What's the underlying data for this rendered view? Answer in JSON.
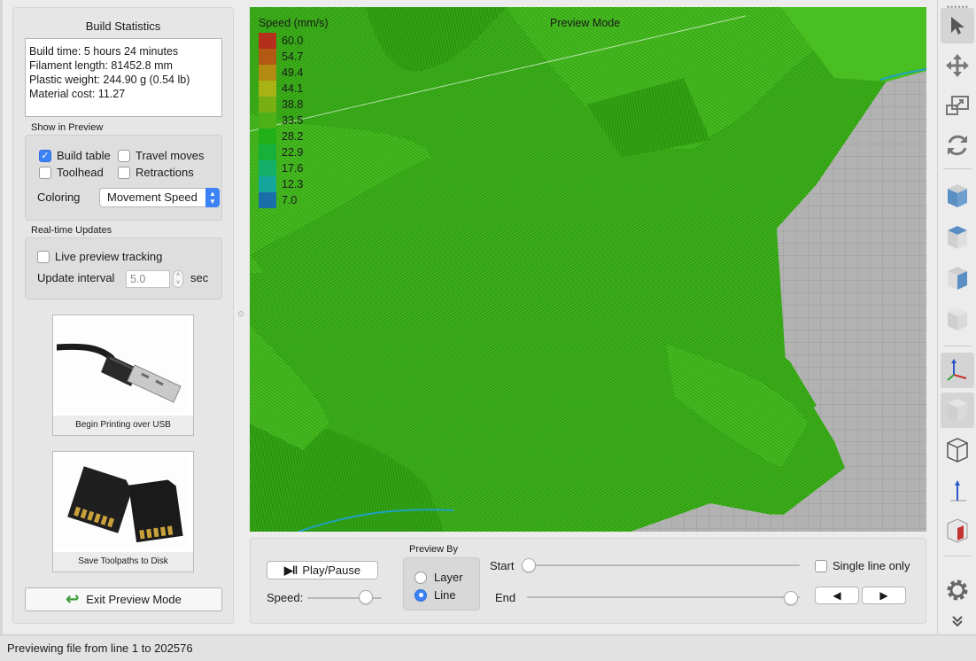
{
  "stats": {
    "title": "Build Statistics",
    "build_time": "Build time: 5 hours 24 minutes",
    "filament_length": "Filament length: 81452.8 mm",
    "plastic_weight": "Plastic weight: 244.90 g (0.54 lb)",
    "material_cost": "Material cost: 11.27"
  },
  "show_in_preview": {
    "label": "Show in Preview",
    "build_table": {
      "label": "Build table",
      "checked": true
    },
    "travel_moves": {
      "label": "Travel moves",
      "checked": false
    },
    "toolhead": {
      "label": "Toolhead",
      "checked": false
    },
    "retractions": {
      "label": "Retractions",
      "checked": false
    },
    "coloring_label": "Coloring",
    "coloring_value": "Movement Speed"
  },
  "realtime": {
    "label": "Real-time Updates",
    "live_tracking": {
      "label": "Live preview tracking",
      "checked": false
    },
    "interval_label": "Update interval",
    "interval_value": "5.0",
    "interval_unit": "sec"
  },
  "tiles": {
    "usb_caption": "Begin Printing over USB",
    "disk_caption": "Save Toolpaths to Disk"
  },
  "exit_button": "Exit Preview Mode",
  "viewport": {
    "mode_label": "Preview Mode",
    "legend_title": "Speed (mm/s)",
    "legend": [
      {
        "value": "60.0",
        "color": "#b5301c"
      },
      {
        "value": "54.7",
        "color": "#b25a14"
      },
      {
        "value": "49.4",
        "color": "#b38a12"
      },
      {
        "value": "44.1",
        "color": "#a8b214"
      },
      {
        "value": "38.8",
        "color": "#78b014"
      },
      {
        "value": "33.5",
        "color": "#4cb016"
      },
      {
        "value": "28.2",
        "color": "#22b018"
      },
      {
        "value": "22.9",
        "color": "#16b03a"
      },
      {
        "value": "17.6",
        "color": "#14b06a"
      },
      {
        "value": "12.3",
        "color": "#14a69a"
      },
      {
        "value": "7.0",
        "color": "#1a6fa8"
      }
    ]
  },
  "controls": {
    "play_pause": "Play/Pause",
    "speed_label": "Speed:",
    "speed_level": 0.78,
    "preview_by_label": "Preview By",
    "layer_option": "Layer",
    "line_option": "Line",
    "selected": "Line",
    "start_label": "Start",
    "end_label": "End",
    "start_position": 0.0,
    "end_position": 1.0,
    "single_line": {
      "label": "Single line only",
      "checked": false
    },
    "prev_icon": "triangle-left-icon",
    "next_icon": "triangle-right-icon"
  },
  "toolbar_icons": [
    "select-arrow-icon",
    "move-icon",
    "scale-icon",
    "rotate-icon",
    "view-front-cube-icon",
    "view-top-cube-icon",
    "view-side-cube-icon",
    "view-iso-cube-icon",
    "axes-icon",
    "solid-view-icon",
    "wireframe-view-icon",
    "normal-axis-icon",
    "cross-section-icon",
    "gear-icon",
    "expand-chevron-icon"
  ],
  "status": "Previewing file from line 1 to 202576"
}
